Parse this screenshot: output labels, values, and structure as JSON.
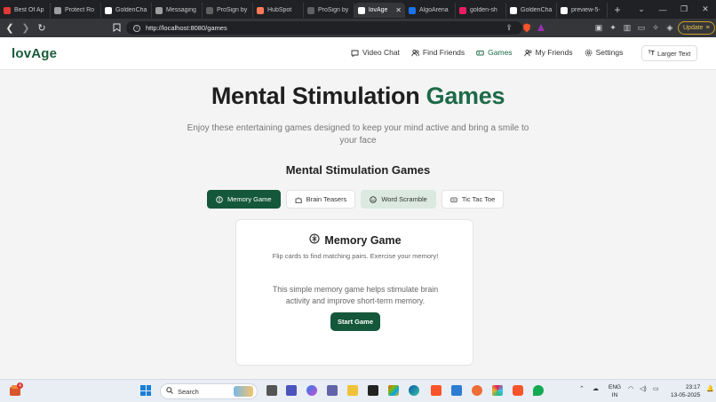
{
  "browser": {
    "tabs": [
      {
        "label": "Best Of Ap",
        "color": "#e53935"
      },
      {
        "label": "Protect Ro",
        "color": "#9e9e9e"
      },
      {
        "label": "GoldenCha",
        "color": "#ffffff"
      },
      {
        "label": "Messaging",
        "color": "#9e9e9e"
      },
      {
        "label": "ProSign by",
        "color": "#616161"
      },
      {
        "label": "HubSpot",
        "color": "#ff7a59"
      },
      {
        "label": "ProSign by",
        "color": "#616161"
      },
      {
        "label": "lovAge",
        "color": "#ffffff",
        "active": true
      },
      {
        "label": "AlgoArena",
        "color": "#1a73e8"
      },
      {
        "label": "golden-sh",
        "color": "#e91e63"
      },
      {
        "label": "GoldenCha",
        "color": "#ffffff"
      },
      {
        "label": "preview-5-",
        "color": "#ffffff"
      }
    ],
    "url": "http://localhost:8080/games",
    "update_label": "Update"
  },
  "app": {
    "logo": "lovAge",
    "nav": [
      {
        "label": "Video Chat",
        "icon": "chat-icon",
        "active": false
      },
      {
        "label": "Find Friends",
        "icon": "users-icon",
        "active": false
      },
      {
        "label": "Games",
        "icon": "gamepad-icon",
        "active": true
      },
      {
        "label": "My Friends",
        "icon": "friends-icon",
        "active": false
      },
      {
        "label": "Settings",
        "icon": "gear-icon",
        "active": false
      }
    ],
    "larger_text_label": "Larger Text"
  },
  "main": {
    "hero_prefix": "Mental Stimulation",
    "hero_accent": "Games",
    "subtitle": "Enjoy these entertaining games designed to keep your mind active and bring a smile to your face",
    "section_title": "Mental Stimulation Games",
    "game_tabs": [
      {
        "label": "Memory Game",
        "icon": "brain-icon",
        "state": "active"
      },
      {
        "label": "Brain Teasers",
        "icon": "puzzle-icon",
        "state": "normal"
      },
      {
        "label": "Word Scramble",
        "icon": "smile-icon",
        "state": "hover"
      },
      {
        "label": "Tic Tac Toe",
        "icon": "grid-icon",
        "state": "normal"
      }
    ],
    "card": {
      "title": "Memory Game",
      "subtitle": "Flip cards to find matching pairs. Exercise your memory!",
      "description": "This simple memory game helps stimulate brain activity and improve short-term memory.",
      "button": "Start Game"
    }
  },
  "taskbar": {
    "search_placeholder": "Search",
    "lang_top": "ENG",
    "lang_bottom": "IN",
    "time": "23:17",
    "date": "13-05-2025",
    "badge": "4"
  },
  "colors": {
    "brand": "#1a5c3a",
    "accent": "#1e6a48",
    "button": "#14573a"
  }
}
